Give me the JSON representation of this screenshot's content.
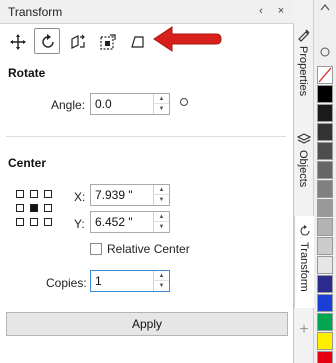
{
  "panel": {
    "title": "Transform",
    "title_controls": [
      "‹",
      "×"
    ]
  },
  "toolbar": {
    "tools": [
      {
        "name": "position",
        "icon": "move-icon"
      },
      {
        "name": "rotate",
        "icon": "rotate-icon",
        "active": true
      },
      {
        "name": "scale-mirror",
        "icon": "scale-mirror-icon"
      },
      {
        "name": "size",
        "icon": "size-icon"
      },
      {
        "name": "skew",
        "icon": "skew-icon"
      }
    ],
    "annotation_color": "#d8201a"
  },
  "rotate": {
    "section_title": "Rotate",
    "angle_label": "Angle:",
    "angle_value": "0.0"
  },
  "center": {
    "section_title": "Center",
    "x_label": "X:",
    "x_value": "7.939 \"",
    "y_label": "Y:",
    "y_value": "6.452 \"",
    "relative_center_label": "Relative Center",
    "relative_center_checked": false
  },
  "copies": {
    "label": "Copies:",
    "value": "1"
  },
  "apply_label": "Apply",
  "side_tabs": [
    {
      "label": "Properties"
    },
    {
      "label": "Objects"
    },
    {
      "label": "Transform",
      "active": true
    }
  ],
  "add_tab_glyph": "+",
  "palette": {
    "colors": [
      "#ffffff",
      "#000000",
      "#1a1a1a",
      "#333333",
      "#4d4d4d",
      "#666666",
      "#808080",
      "#999999",
      "#b3b3b3",
      "#cccccc",
      "#e6e6e6",
      "#2b2b8f",
      "#1a3fd6",
      "#00a650",
      "#ffee00",
      "#e60012"
    ]
  },
  "accent_color": "#3c8cd8"
}
